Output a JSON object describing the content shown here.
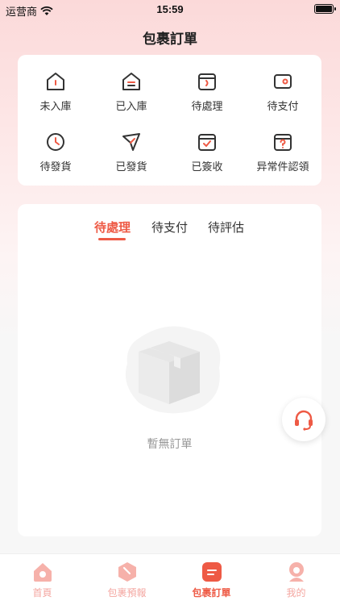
{
  "status_bar": {
    "carrier": "运营商",
    "time": "15:59"
  },
  "page": {
    "title": "包裹訂單"
  },
  "status_grid": [
    {
      "label": "未入庫",
      "icon": "house-icon"
    },
    {
      "label": "已入庫",
      "icon": "house-stored-icon"
    },
    {
      "label": "待處理",
      "icon": "box-pending-icon"
    },
    {
      "label": "待支付",
      "icon": "wallet-icon"
    },
    {
      "label": "待發貨",
      "icon": "clock-icon"
    },
    {
      "label": "已發貨",
      "icon": "send-icon"
    },
    {
      "label": "已簽收",
      "icon": "box-check-icon"
    },
    {
      "label": "异常件認領",
      "icon": "box-question-icon"
    }
  ],
  "order_tabs": [
    {
      "label": "待處理",
      "active": true
    },
    {
      "label": "待支付",
      "active": false
    },
    {
      "label": "待評估",
      "active": false
    }
  ],
  "empty_state": {
    "text": "暫無訂單"
  },
  "tab_bar": [
    {
      "label": "首頁",
      "icon": "home-icon",
      "active": false
    },
    {
      "label": "包裹預報",
      "icon": "parcel-forecast-icon",
      "active": false
    },
    {
      "label": "包裹訂單",
      "icon": "parcel-orders-icon",
      "active": true
    },
    {
      "label": "我的",
      "icon": "profile-icon",
      "active": false
    }
  ],
  "colors": {
    "accent": "#ee5a45",
    "inactive_tab": "#f4a6a0",
    "text": "#333333",
    "muted": "#999999"
  }
}
